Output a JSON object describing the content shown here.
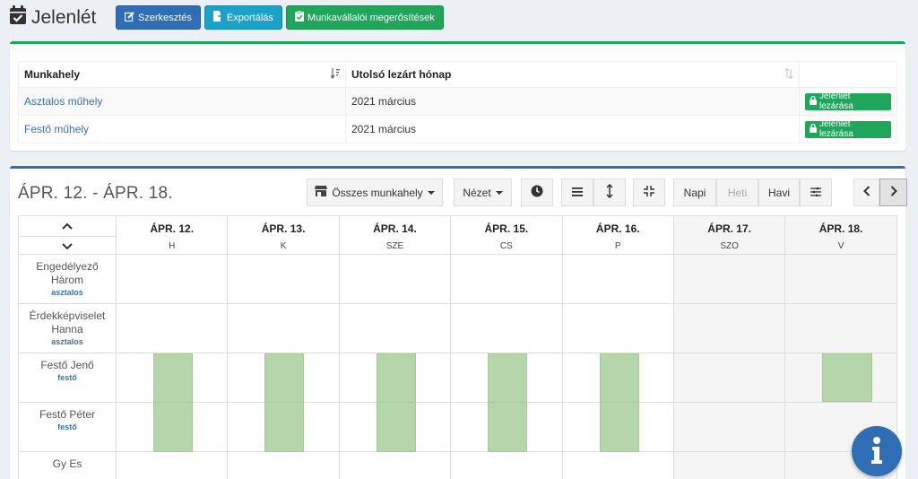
{
  "header": {
    "title": "Jelenlét",
    "buttons": {
      "edit": "Szerkesztés",
      "export": "Exportálás",
      "confirm": "Munkavállalói megerősítések"
    }
  },
  "workplaces_table": {
    "headers": [
      "Munkahely",
      "Utolsó lezárt hónap",
      ""
    ],
    "rows": [
      {
        "name": "Asztalos műhely",
        "month": "2021 március",
        "action": "Jelenlét lezárása"
      },
      {
        "name": "Festő műhely",
        "month": "2021 március",
        "action": "Jelenlét lezárása"
      }
    ]
  },
  "calendar": {
    "range_title": "ÁPR. 12. - ÁPR. 18.",
    "toolbar": {
      "workplace_filter": "Összes munkahely",
      "view": "Nézet",
      "daily": "Napi",
      "weekly": "Heti",
      "monthly": "Havi"
    },
    "days": [
      {
        "date": "ÁPR. 12.",
        "abbr": "H"
      },
      {
        "date": "ÁPR. 13.",
        "abbr": "K"
      },
      {
        "date": "ÁPR. 14.",
        "abbr": "SZE"
      },
      {
        "date": "ÁPR. 15.",
        "abbr": "CS"
      },
      {
        "date": "ÁPR. 16.",
        "abbr": "P"
      },
      {
        "date": "ÁPR. 17.",
        "abbr": "SZO"
      },
      {
        "date": "ÁPR. 18.",
        "abbr": "V"
      }
    ],
    "employees": [
      {
        "name": "Engedélyező Három",
        "role": "asztalos"
      },
      {
        "name": "Érdekképviselet Hanna",
        "role": "asztalos"
      },
      {
        "name": "Festő Jenő",
        "role": "festő"
      },
      {
        "name": "Festő Péter",
        "role": "festő"
      },
      {
        "name": "Gy Es",
        "role": ""
      }
    ]
  },
  "colors": {
    "green": "#1fa65a",
    "blue": "#2f6db5",
    "cyan": "#1ba2c9",
    "shift": "#b5d6aa"
  }
}
